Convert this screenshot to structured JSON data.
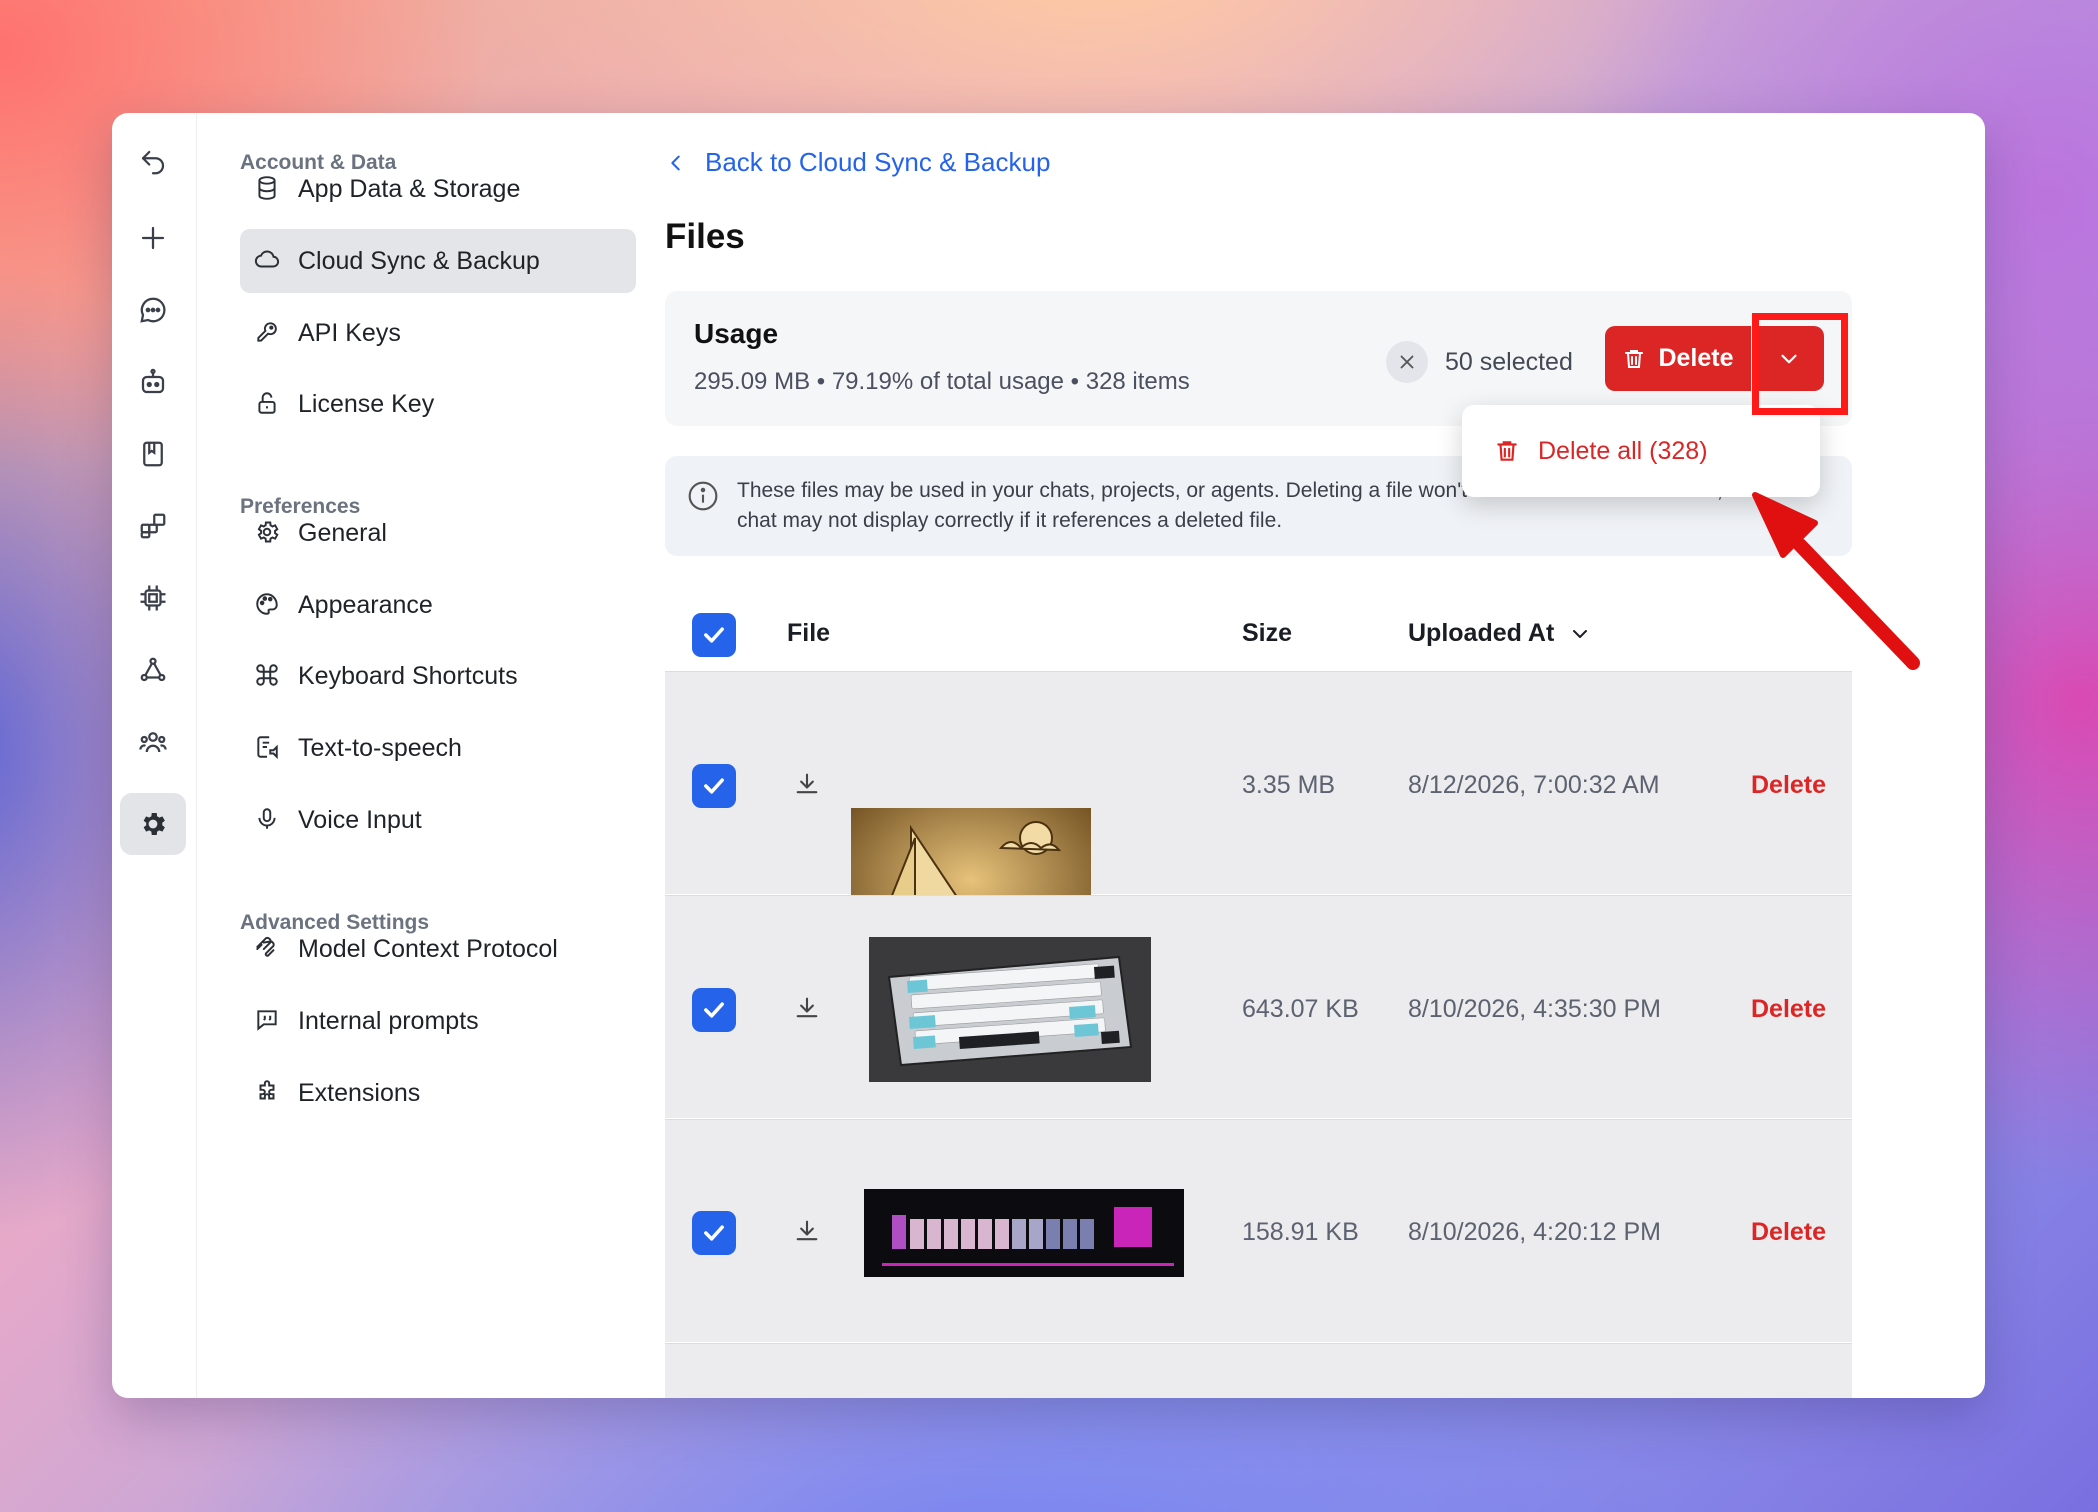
{
  "nav": {
    "sections": [
      {
        "label": "Account & Data"
      },
      {
        "label": "Preferences"
      },
      {
        "label": "Advanced Settings"
      }
    ],
    "items": [
      {
        "label": "App Data & Storage",
        "icon": "database-icon"
      },
      {
        "label": "Cloud Sync & Backup",
        "icon": "cloud-icon",
        "active": true
      },
      {
        "label": "API Keys",
        "icon": "key-icon"
      },
      {
        "label": "License Key",
        "icon": "lock-icon"
      },
      {
        "label": "General",
        "icon": "gear-icon"
      },
      {
        "label": "Appearance",
        "icon": "palette-icon"
      },
      {
        "label": "Keyboard Shortcuts",
        "icon": "command-icon"
      },
      {
        "label": "Text-to-speech",
        "icon": "speech-icon"
      },
      {
        "label": "Voice Input",
        "icon": "microphone-icon"
      },
      {
        "label": "Model Context Protocol",
        "icon": "mcp-icon"
      },
      {
        "label": "Internal prompts",
        "icon": "quote-icon"
      },
      {
        "label": "Extensions",
        "icon": "puzzle-icon"
      }
    ]
  },
  "rail": [
    "undo-icon",
    "plus-icon",
    "chat-icon",
    "agents-icon",
    "book-icon",
    "apps-icon",
    "chip-icon",
    "network-icon",
    "team-icon",
    "settings-icon"
  ],
  "main": {
    "back_label": "Back to Cloud Sync & Backup",
    "title": "Files",
    "usage": {
      "title": "Usage",
      "stats": "295.09 MB • 79.19% of total usage • 328 items",
      "selected": "50 selected",
      "delete_label": "Delete"
    },
    "dropdown": {
      "delete_all": "Delete all (328)"
    },
    "info": "These files may be used in your chats, projects, or agents. Deleting a file won't delete the associated chat, but the chat may not display correctly if it references a deleted file.",
    "table": {
      "headers": {
        "file": "File",
        "size": "Size",
        "uploaded": "Uploaded At"
      },
      "rows": [
        {
          "size": "3.35 MB",
          "date": "8/12/2026, 7:00:32 AM",
          "action": "Delete",
          "thumb": "sailboat-carving"
        },
        {
          "size": "643.07 KB",
          "date": "8/10/2026, 4:35:30 PM",
          "action": "Delete",
          "thumb": "keyboard-photo"
        },
        {
          "size": "158.91 KB",
          "date": "8/10/2026, 4:20:12 PM",
          "action": "Delete",
          "thumb": "bar-graphic"
        }
      ]
    }
  },
  "colors": {
    "accent": "#2563eb",
    "danger": "#dc2626",
    "highlight": "#ff1a1a"
  }
}
